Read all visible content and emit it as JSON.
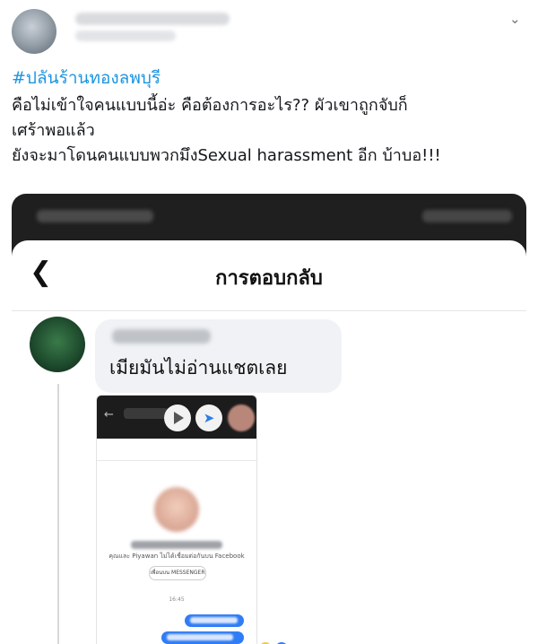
{
  "tweet": {
    "hashtag": "#ปลันร้านทองลพบุรี",
    "text": "คือไม่เข้าใจคนแบบนี้อ่ะ คือต้องการอะไร?? ผัวเขาถูกจับก็\nเศร้าพอแล้ว\nยังจะมาโดนคนแบบพวกมึงSexual harassment อีก บ้าบอ!!!",
    "more_icon": "chevron-down-icon"
  },
  "screenshot": {
    "header_title": "การตอบกลับ",
    "back_icon": "chevron-left-icon",
    "comment_text": "เมียมันไม่อ่านแชตเลย",
    "inner": {
      "subtitle": "คุณและ Piyawan ไม่ได้เชื่อมต่อกันบน Facebook",
      "chip_label": "เพื่อนบน MESSENGER",
      "time": "16:45"
    }
  }
}
